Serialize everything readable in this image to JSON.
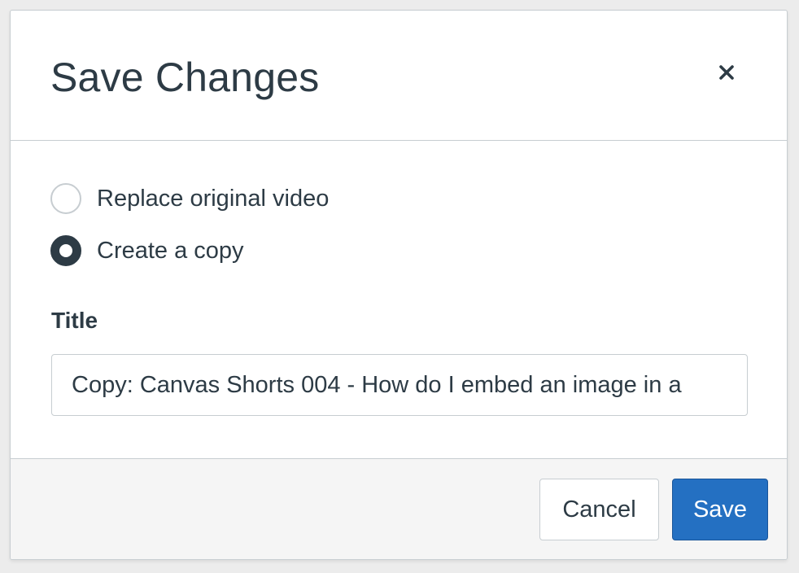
{
  "dialog": {
    "title": "Save Changes",
    "close_icon": "close-icon"
  },
  "options": [
    {
      "label": "Replace original video",
      "checked": false
    },
    {
      "label": "Create a copy",
      "checked": true
    }
  ],
  "title_field": {
    "label": "Title",
    "value": "Copy: Canvas Shorts 004 - How do I embed an image in a"
  },
  "footer": {
    "cancel_label": "Cancel",
    "save_label": "Save"
  },
  "colors": {
    "primary": "#2470c2",
    "text": "#2d3b45",
    "border": "#c7cdd1",
    "footer_bg": "#f5f5f5"
  }
}
